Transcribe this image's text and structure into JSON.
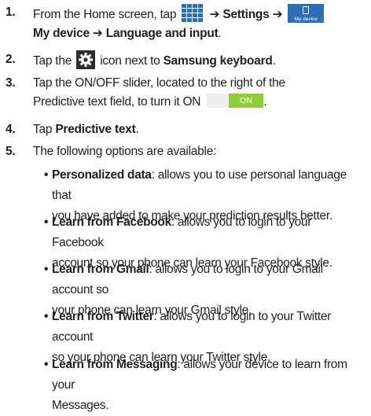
{
  "steps": [
    {
      "num": "1.",
      "t1": "From the Home screen, tap",
      "arrow1": "➔",
      "settings": "Settings",
      "arrow2": "➔",
      "my_device_icon_label": "My device",
      "my_device": "My device",
      "arrow3": "➔",
      "lang_input": "Language and input",
      "end": "."
    },
    {
      "num": "2.",
      "t1": "Tap the",
      "t2": "icon next to",
      "samsung_keyboard": "Samsung keyboard",
      "end": "."
    },
    {
      "num": "3.",
      "line1": "Tap the ON/OFF slider, located to the right of the",
      "line2": "Predictive text field, to turn it ON",
      "toggle_label": "ON",
      "end": "."
    },
    {
      "num": "4.",
      "t1": "Tap",
      "predictive": "Predictive text",
      "end": "."
    },
    {
      "num": "5.",
      "t1": "The following options are available:"
    }
  ],
  "options": [
    {
      "bold": "Personalized data",
      "line1": ": allows you to use personal language that",
      "line2": "you have added to make your prediction results better."
    },
    {
      "bold": "Learn from Facebook",
      "line1": ": allows you to login to your Facebook",
      "line2": "account so your phone can learn your Facebook style."
    },
    {
      "bold": "Learn from Gmail",
      "line1": ": allows you to login to your Gmail account so",
      "line2": "your phone can learn your Gmail style."
    },
    {
      "bold": "Learn from Twitter",
      "line1": ": allows you to login to your Twitter account",
      "line2": "so your phone can learn your Twitter style."
    },
    {
      "bold": "Learn from Messaging",
      "line1": ": allows your device to learn from your",
      "line2": "Messages."
    }
  ],
  "bullet_char": "•",
  "colors": {
    "grid_icon": "#2d6fb5",
    "my_device_icon": "#2d6fb5",
    "gear_icon_bg": "#2e2e2e",
    "toggle_on": "#8dcc3a"
  },
  "icons": [
    "apps-grid-icon",
    "my-device-icon",
    "gear-icon"
  ]
}
